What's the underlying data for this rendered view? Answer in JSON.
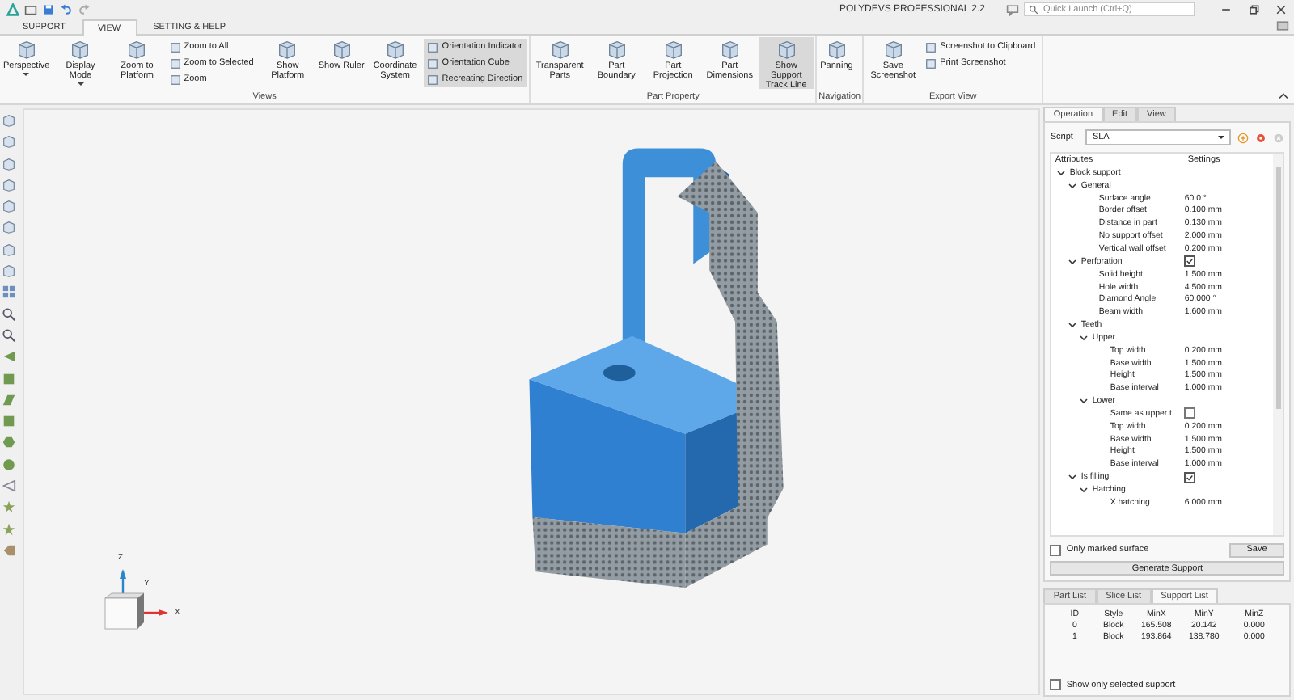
{
  "titlebar": {
    "title": "POLYDEVS PROFESSIONAL 2.2",
    "search": {
      "placeholder": "Quick Launch (Ctrl+Q)"
    }
  },
  "menu_tabs": [
    {
      "label": "SUPPORT",
      "selected": false
    },
    {
      "label": "VIEW",
      "selected": true
    },
    {
      "label": "SETTING & HELP",
      "selected": false
    }
  ],
  "ribbon": [
    {
      "title": "Views",
      "items": [
        {
          "kind": "large",
          "label": "Perspective",
          "dropdown": true,
          "on": false
        },
        {
          "kind": "large",
          "label": "Display Mode",
          "dropdown": true,
          "on": false
        },
        {
          "kind": "large",
          "label": "Zoom to Platform",
          "on": false
        },
        {
          "kind": "stack",
          "items": [
            {
              "label": "Zoom to All",
              "on": false
            },
            {
              "label": "Zoom to Selected",
              "on": false
            },
            {
              "label": "Zoom",
              "on": false
            }
          ]
        },
        {
          "kind": "large",
          "label": "Show Platform",
          "on": false
        },
        {
          "kind": "large",
          "label": "Show Ruler",
          "on": false
        },
        {
          "kind": "large",
          "label": "Coordinate System",
          "on": false
        },
        {
          "kind": "stack",
          "items": [
            {
              "label": "Orientation Indicator",
              "on": true
            },
            {
              "label": "Orientation Cube",
              "on": true
            },
            {
              "label": "Recreating Direction",
              "on": true
            }
          ]
        }
      ]
    },
    {
      "title": "Part Property",
      "items": [
        {
          "kind": "large",
          "label": "Transparent Parts",
          "on": false
        },
        {
          "kind": "large",
          "label": "Part Boundary",
          "on": false
        },
        {
          "kind": "large",
          "label": "Part Projection",
          "on": false
        },
        {
          "kind": "large",
          "label": "Part Dimensions",
          "on": false
        },
        {
          "kind": "large",
          "label": "Show Support Track Line",
          "on": true
        }
      ]
    },
    {
      "title": "Navigation",
      "items": [
        {
          "kind": "large",
          "label": "Panning",
          "on": false
        }
      ]
    },
    {
      "title": "Export View",
      "items": [
        {
          "kind": "large",
          "label": "Save Screenshot",
          "on": false
        },
        {
          "kind": "stack",
          "items": [
            {
              "label": "Screenshot to Clipboard",
              "on": false
            },
            {
              "label": "Print Screenshot",
              "on": false
            }
          ]
        }
      ]
    }
  ],
  "viewport": {
    "axis_labels": {
      "z": "Z",
      "y": "Y",
      "x": "X"
    }
  },
  "panel": {
    "tabs": [
      {
        "label": "Operation",
        "selected": true
      },
      {
        "label": "Edit",
        "selected": false
      },
      {
        "label": "View",
        "selected": false
      }
    ],
    "script": {
      "label": "Script",
      "value": "SLA"
    },
    "tree_header": {
      "attributes": "Attributes",
      "settings": "Settings"
    },
    "tree": [
      {
        "label": "Block support",
        "expanded": true,
        "children": [
          {
            "label": "General",
            "expanded": true,
            "children": [
              {
                "label": "Surface angle",
                "value": "60.0 °"
              },
              {
                "label": "Border offset",
                "value": "0.100 mm"
              },
              {
                "label": "Distance in part",
                "value": "0.130 mm"
              },
              {
                "label": "No support offset",
                "value": "2.000 mm"
              },
              {
                "label": "Vertical wall offset",
                "value": "0.200 mm"
              }
            ]
          },
          {
            "label": "Perforation",
            "expanded": true,
            "checked": true,
            "children": [
              {
                "label": "Solid height",
                "value": "1.500 mm"
              },
              {
                "label": "Hole width",
                "value": "4.500 mm"
              },
              {
                "label": "Diamond Angle",
                "value": "60.000 °"
              },
              {
                "label": "Beam width",
                "value": "1.600 mm"
              }
            ]
          },
          {
            "label": "Teeth",
            "expanded": true,
            "children": [
              {
                "label": "Upper",
                "expanded": true,
                "children": [
                  {
                    "label": "Top width",
                    "value": "0.200 mm"
                  },
                  {
                    "label": "Base width",
                    "value": "1.500 mm"
                  },
                  {
                    "label": "Height",
                    "value": "1.500 mm"
                  },
                  {
                    "label": "Base interval",
                    "value": "1.000 mm"
                  }
                ]
              },
              {
                "label": "Lower",
                "expanded": true,
                "children": [
                  {
                    "label": "Same as upper t...",
                    "checked": false
                  },
                  {
                    "label": "Top width",
                    "value": "0.200 mm"
                  },
                  {
                    "label": "Base width",
                    "value": "1.500 mm"
                  },
                  {
                    "label": "Height",
                    "value": "1.500 mm"
                  },
                  {
                    "label": "Base interval",
                    "value": "1.000 mm"
                  }
                ]
              }
            ]
          },
          {
            "label": "Is filling",
            "expanded": true,
            "checked": true,
            "children": [
              {
                "label": "Hatching",
                "expanded": true,
                "children": [
                  {
                    "label": "X hatching",
                    "value": "6.000 mm"
                  }
                ]
              }
            ]
          }
        ]
      }
    ],
    "only_marked_surface": {
      "label": "Only marked surface",
      "checked": false
    },
    "save": "Save",
    "generate": "Generate Support"
  },
  "list_panel": {
    "tabs": [
      {
        "label": "Part List",
        "selected": false
      },
      {
        "label": "Slice List",
        "selected": false
      },
      {
        "label": "Support List",
        "selected": true
      }
    ],
    "columns": [
      "ID",
      "Style",
      "MinX",
      "MinY",
      "MinZ"
    ],
    "rows": [
      [
        "0",
        "Block",
        "165.508",
        "20.142",
        "0.000"
      ],
      [
        "1",
        "Block",
        "193.864",
        "138.780",
        "0.000"
      ]
    ],
    "show_only_selected": {
      "label": "Show only selected support",
      "checked": false
    }
  }
}
